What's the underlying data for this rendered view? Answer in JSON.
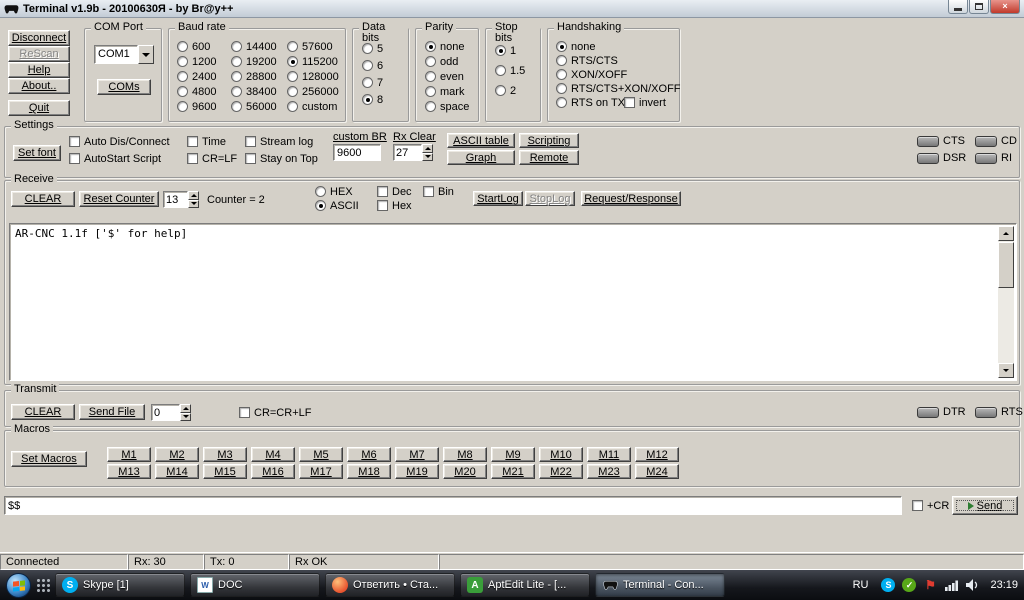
{
  "window": {
    "title": "Terminal v1.9b - 20100630Я - by Br@y++",
    "close_glyph": "×"
  },
  "connection": {
    "disconnect": "Disconnect",
    "rescan": "ReScan",
    "help": "Help",
    "about": "About..",
    "quit": "Quit"
  },
  "com_port": {
    "group_label": "COM Port",
    "selected_port": "COM1",
    "coms_button": "COMs"
  },
  "baud": {
    "group_label": "Baud rate",
    "col1": [
      "600",
      "1200",
      "2400",
      "4800",
      "9600"
    ],
    "col2": [
      "14400",
      "19200",
      "28800",
      "38400",
      "56000"
    ],
    "col3": [
      "57600",
      "115200",
      "128000",
      "256000",
      "custom"
    ],
    "selected": "115200"
  },
  "data_bits": {
    "group_label": "Data bits",
    "options": [
      "5",
      "6",
      "7",
      "8"
    ],
    "selected": "8"
  },
  "parity": {
    "group_label": "Parity",
    "options": [
      "none",
      "odd",
      "even",
      "mark",
      "space"
    ],
    "selected": "none"
  },
  "stop_bits": {
    "group_label": "Stop bits",
    "options": [
      "1",
      "1.5",
      "2"
    ],
    "selected": "1"
  },
  "handshaking": {
    "group_label": "Handshaking",
    "options": [
      "none",
      "RTS/CTS",
      "XON/XOFF",
      "RTS/CTS+XON/XOFF",
      "RTS on TX"
    ],
    "selected": "none",
    "invert_label": "invert"
  },
  "settings": {
    "group_label": "Settings",
    "set_font": "Set font",
    "auto_connect": "Auto Dis/Connect",
    "autostart": "AutoStart Script",
    "time": "Time",
    "crlf": "CR=LF",
    "stream_log": "Stream log",
    "stay_on_top": "Stay on Top",
    "custom_br_label": "custom BR",
    "custom_br_value": "9600",
    "rx_clear_label": "Rx Clear",
    "rx_clear_value": "27",
    "ascii_table": "ASCII table",
    "scripting": "Scripting",
    "graph": "Graph",
    "remote": "Remote",
    "leds": {
      "cts": "CTS",
      "dsr": "DSR",
      "cd": "CD",
      "ri": "RI"
    }
  },
  "receive": {
    "group_label": "Receive",
    "clear": "CLEAR",
    "reset_counter": "Reset Counter",
    "spin_value": "13",
    "counter_text": "Counter =  2",
    "modes": [
      "HEX",
      "ASCII"
    ],
    "selected_mode": "ASCII",
    "chk_dec": "Dec",
    "chk_hex": "Hex",
    "chk_bin": "Bin",
    "start_log": "StartLog",
    "stop_log": "StopLog",
    "req_resp": "Request/Response",
    "terminal_text": "AR-CNC 1.1f ['$' for help]"
  },
  "transmit": {
    "group_label": "Transmit",
    "clear": "CLEAR",
    "send_file": "Send File",
    "spin_value": "0",
    "crcrlf": "CR=CR+LF",
    "leds": {
      "dtr": "DTR",
      "rts": "RTS"
    }
  },
  "macros": {
    "group_label": "Macros",
    "set_macros": "Set Macros",
    "row1": [
      "M1",
      "M2",
      "M3",
      "M4",
      "M5",
      "M6",
      "M7",
      "M8",
      "M9",
      "M10",
      "M11",
      "M12"
    ],
    "row2": [
      "M13",
      "M14",
      "M15",
      "M16",
      "M17",
      "M18",
      "M19",
      "M20",
      "M21",
      "M22",
      "M23",
      "M24"
    ]
  },
  "send_bar": {
    "input_value": "$$",
    "cr_label": "+CR",
    "send_button": "Send"
  },
  "status_bar": {
    "connected": "Connected",
    "rx": "Rx: 30",
    "tx": "Tx: 0",
    "rx_ok": "Rx OK"
  },
  "taskbar": {
    "items": [
      {
        "label": "Skype [1]",
        "icon_glyph": "S"
      },
      {
        "label": "DOC",
        "icon_glyph": "W"
      },
      {
        "label": "Ответить • Ста...",
        "icon_glyph": ""
      },
      {
        "label": "AptEdit Lite - [...",
        "icon_glyph": "A"
      },
      {
        "label": "Terminal - Con...",
        "icon_glyph": ""
      }
    ],
    "language": "RU",
    "tray_glyphs": {
      "skype": "S",
      "antivirus": "✓",
      "flag": "⚑"
    },
    "clock": "23:19"
  }
}
